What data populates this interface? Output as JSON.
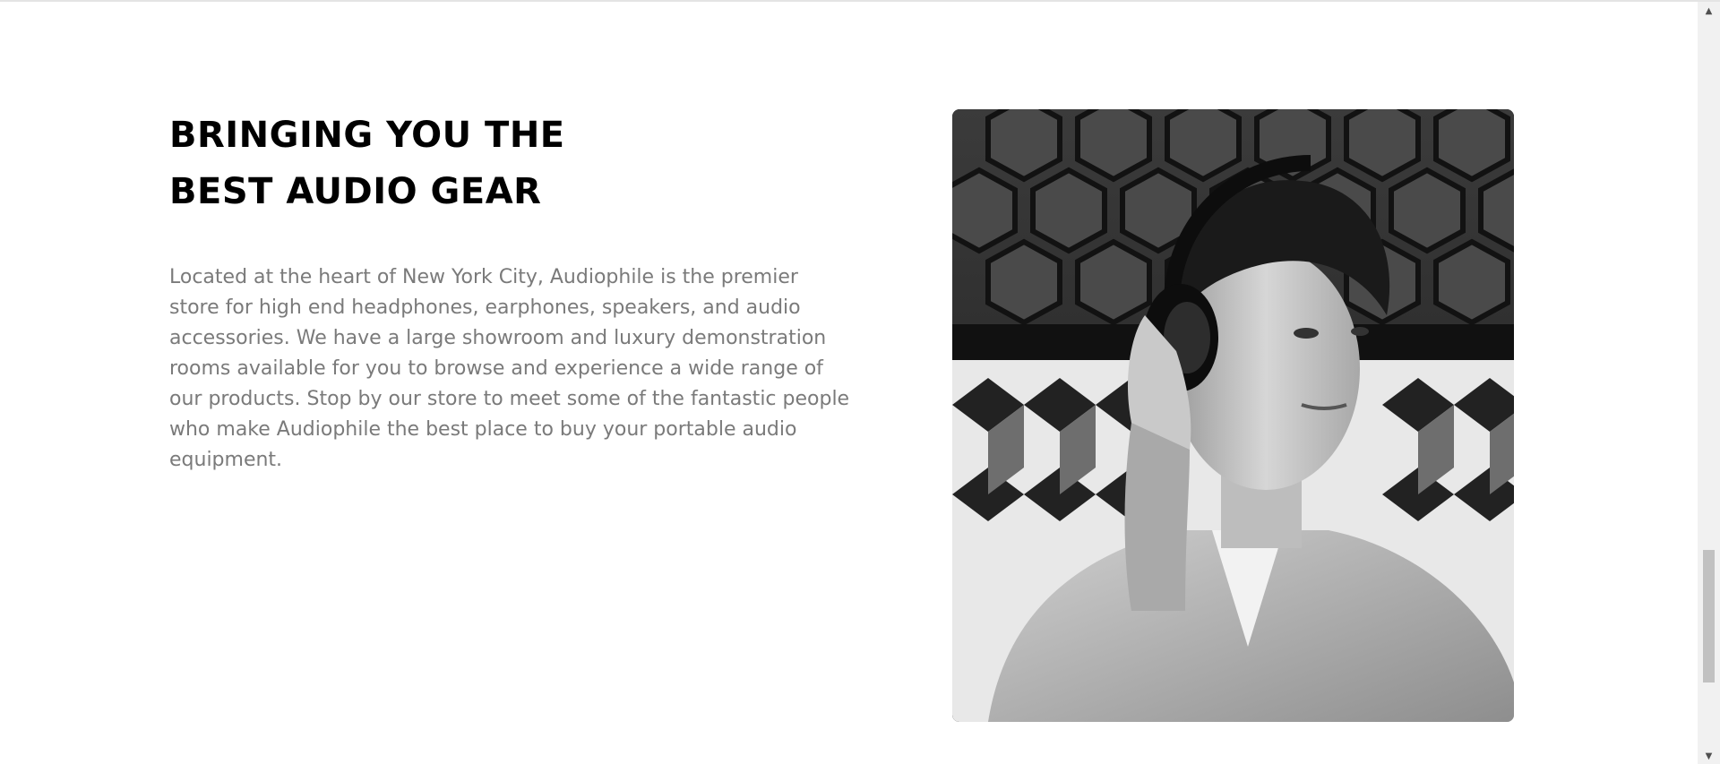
{
  "about": {
    "heading_line1": "BRINGING YOU THE",
    "heading_line2": "BEST AUDIO GEAR",
    "body": "Located at the heart of New York City, Audiophile is the premier store for high end headphones, earphones, speakers, and audio accessories. We have a large showroom and luxury demonstration rooms available for you to browse and experience a wide range of our products. Stop by our store to meet some of the fantastic people who make Audiophile the best place to buy your portable audio equipment.",
    "photo_label": "man wearing headphones"
  },
  "scrollbar": {
    "up_icon": "chevron-up-icon",
    "down_icon": "chevron-down-icon",
    "position_fraction": 0.72
  }
}
